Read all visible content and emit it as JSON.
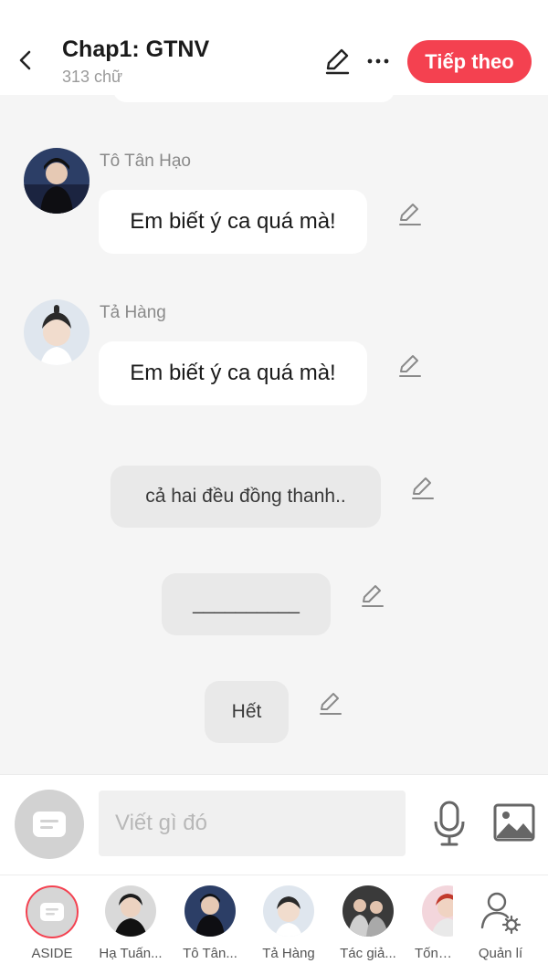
{
  "header": {
    "title": "Chap1: GTNV",
    "word_count": "313 chữ",
    "next_label": "Tiếp theo",
    "accent": "#f44150"
  },
  "messages": [
    {
      "sender": "Tô Tân Hạo",
      "text": "Em biết ý ca quá mà!"
    },
    {
      "sender": "Tả Hàng",
      "text": "Em biết ý ca quá mà!"
    }
  ],
  "narrations": [
    {
      "text": "cả hai đều đồng thanh.."
    },
    {
      "text": "__________"
    },
    {
      "text": "Hết"
    }
  ],
  "composer": {
    "placeholder": "Viết gì đó",
    "icons": [
      "aside-icon",
      "microphone-icon",
      "image-icon"
    ]
  },
  "characters": [
    {
      "label": "ASIDE"
    },
    {
      "label": "Hạ Tuấn..."
    },
    {
      "label": "Tô Tân..."
    },
    {
      "label": "Tả Hàng"
    },
    {
      "label": "Tác giả..."
    },
    {
      "label": "Tống ."
    },
    {
      "label": "Quản lí"
    }
  ]
}
